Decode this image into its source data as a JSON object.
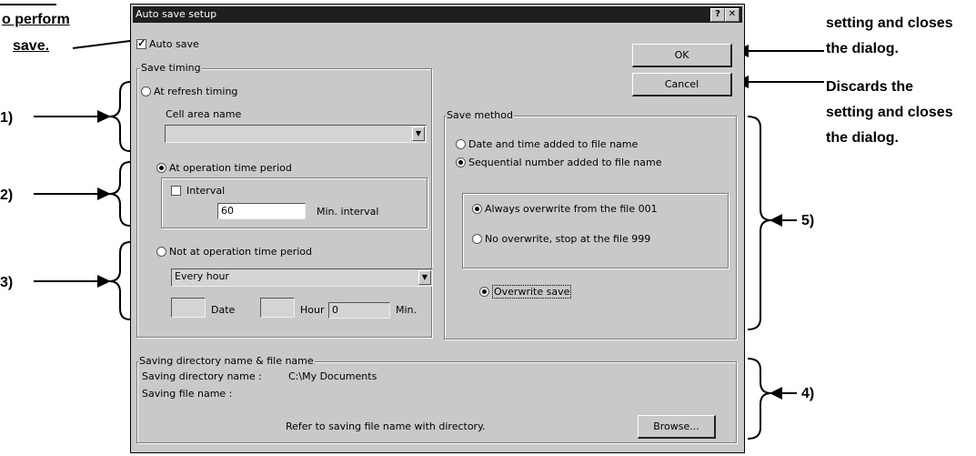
{
  "annotations": {
    "top_left_line1": "o perform",
    "top_left_line2": "save.",
    "top_right_line1": "setting and closes",
    "top_right_line2": "the dialog.",
    "discard_line1": "Discards the",
    "discard_line2": "setting and closes",
    "discard_line3": "the dialog.",
    "marker_1": "1)",
    "marker_2": "2)",
    "marker_3": "3)",
    "marker_4": "4)",
    "marker_5": "5)"
  },
  "dialog": {
    "title": "Auto save setup",
    "help_icon": "question-icon",
    "close_icon": "close-icon",
    "auto_save_label": "Auto save",
    "auto_save_checked": true,
    "ok_label": "OK",
    "cancel_label": "Cancel",
    "save_timing": {
      "label": "Save timing",
      "at_refresh_label": "At refresh timing",
      "cell_area_label": "Cell area name",
      "cell_area_value": "",
      "at_operation_label": "At operation time period",
      "interval_label": "Interval",
      "interval_value": "60",
      "min_interval_label": "Min. interval",
      "not_at_operation_label": "Not at operation time period",
      "every_value": "Every hour",
      "date_value": "",
      "date_label": "Date",
      "hour_value": "",
      "hour_label": "Hour",
      "min_value": "0",
      "min_label": "Min."
    },
    "save_method": {
      "label": "Save method",
      "date_time_label": "Date and time added to file name",
      "sequential_label": "Sequential number added to file name",
      "always_overwrite_label": "Always overwrite from the file 001",
      "no_overwrite_label": "No overwrite, stop at the file 999",
      "overwrite_save_label": "Overwrite save"
    },
    "saving": {
      "label": "Saving directory name & file name",
      "dir_label": "Saving directory name :",
      "dir_value": "C:\\My Documents",
      "file_label": "Saving file name :",
      "refer_text": "Refer to saving file name with directory.",
      "browse_label": "Browse..."
    }
  }
}
